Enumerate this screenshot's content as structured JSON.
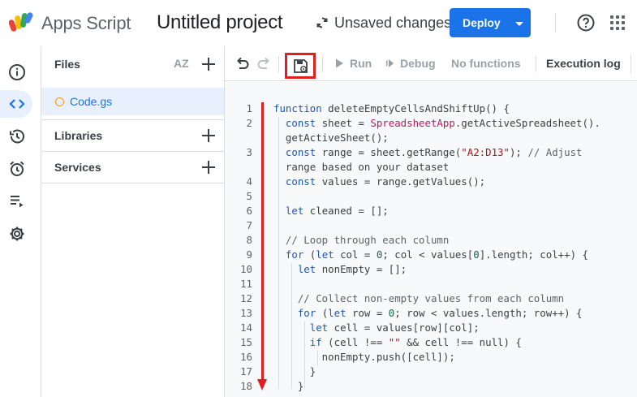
{
  "header": {
    "app_name": "Apps Script",
    "project_title": "Untitled project",
    "status_text": "Unsaved changes",
    "deploy_label": "Deploy"
  },
  "files_panel": {
    "files_label": "Files",
    "sort_label": "AZ",
    "file_name": "Code.gs",
    "libraries_label": "Libraries",
    "services_label": "Services"
  },
  "toolbar": {
    "run_label": "Run",
    "debug_label": "Debug",
    "function_select": "No functions",
    "execution_log_label": "Execution log"
  },
  "editor": {
    "line_numbers": [
      "1",
      "2",
      "",
      "3",
      "",
      "4",
      "5",
      "6",
      "7",
      "8",
      "9",
      "10",
      "11",
      "12",
      "13",
      "14",
      "15",
      "16",
      "17",
      "18"
    ],
    "lines": [
      "function deleteEmptyCellsAndShiftUp() {",
      "  const sheet = SpreadsheetApp.getActiveSpreadsheet().",
      "  getActiveSheet();",
      "  const range = sheet.getRange(\"A2:D13\"); // Adjust",
      "  range based on your dataset",
      "  const values = range.getValues();",
      "",
      "  let cleaned = [];",
      "",
      "  // Loop through each column",
      "  for (let col = 0; col < values[0].length; col++) {",
      "    let nonEmpty = [];",
      "",
      "    // Collect non-empty values from each column",
      "    for (let row = 0; row < values.length; row++) {",
      "      let cell = values[row][col];",
      "      if (cell !== \"\" && cell !== null) {",
      "        nonEmpty.push([cell]);",
      "      }",
      "    }"
    ]
  },
  "colors": {
    "accent": "#1a73e8",
    "annotation": "#e02020",
    "file_dot": "#f29900"
  },
  "icons": [
    "apps-script-logo",
    "sync-icon",
    "help-icon",
    "apps-grid-icon",
    "info-icon",
    "code-icon",
    "history-icon",
    "alarm-icon",
    "playlist-icon",
    "gear-icon",
    "sort-az-icon",
    "plus-icon",
    "undo-icon",
    "redo-icon",
    "save-icon",
    "play-icon",
    "debug-icon"
  ]
}
